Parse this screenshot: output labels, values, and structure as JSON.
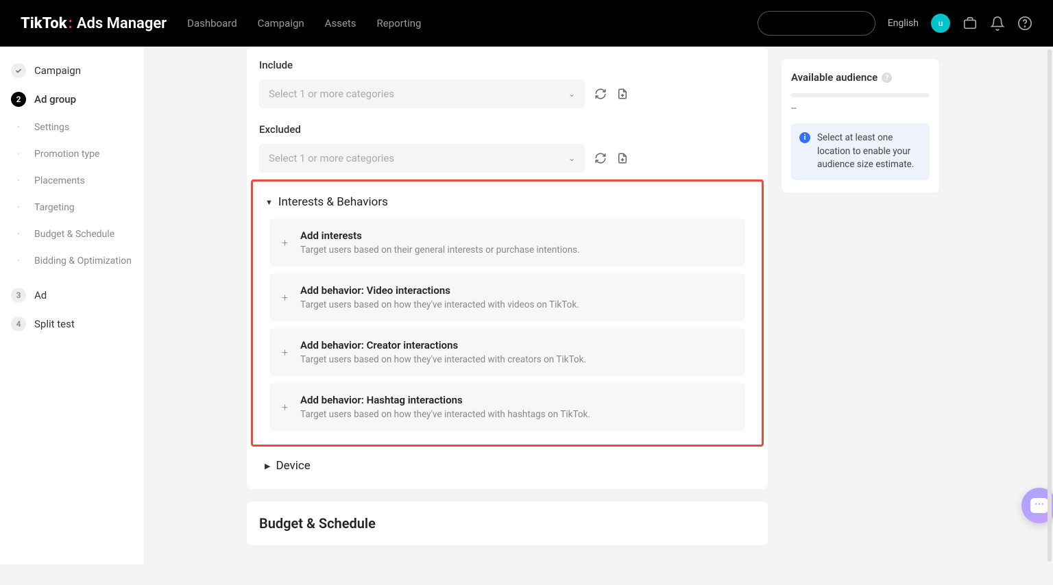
{
  "header": {
    "logo_main": "TikTok",
    "logo_sub": "Ads Manager",
    "nav": [
      "Dashboard",
      "Campaign",
      "Assets",
      "Reporting"
    ],
    "language": "English",
    "avatar_initial": "u"
  },
  "sidebar": {
    "steps": [
      {
        "type": "check",
        "label": "Campaign"
      },
      {
        "type": "active",
        "num": "2",
        "label": "Ad group"
      }
    ],
    "subs": [
      "Settings",
      "Promotion type",
      "Placements",
      "Targeting",
      "Budget & Schedule",
      "Bidding & Optimization"
    ],
    "more": [
      {
        "num": "3",
        "label": "Ad"
      },
      {
        "num": "4",
        "label": "Split test"
      }
    ]
  },
  "include": {
    "label": "Include",
    "placeholder": "Select 1 or more categories"
  },
  "excluded": {
    "label": "Excluded",
    "placeholder": "Select 1 or more categories"
  },
  "interests": {
    "title": "Interests & Behaviors",
    "options": [
      {
        "title": "Add interests",
        "desc": "Target users based on their general interests or purchase intentions."
      },
      {
        "title": "Add behavior: Video interactions",
        "desc": "Target users based on how they've interacted with videos on TikTok."
      },
      {
        "title": "Add behavior: Creator interactions",
        "desc": "Target users based on how they've interacted with creators on TikTok."
      },
      {
        "title": "Add behavior: Hashtag interactions",
        "desc": "Target users based on how they've interacted with hashtags on TikTok."
      }
    ]
  },
  "device_title": "Device",
  "budget_heading": "Budget & Schedule",
  "audience": {
    "title": "Available audience",
    "dash": "--",
    "info": "Select at least one location to enable your audience size estimate."
  }
}
